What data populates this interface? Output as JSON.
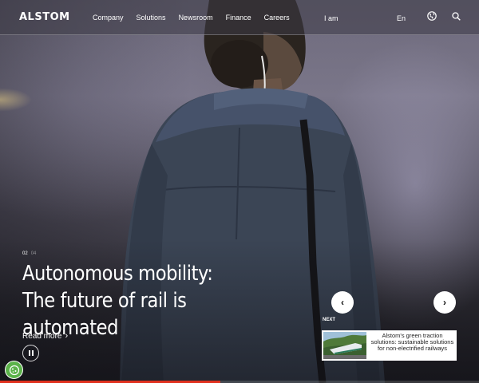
{
  "header": {
    "logo": "ALSTOM",
    "nav": [
      "Company",
      "Solutions",
      "Newsroom",
      "Finance",
      "Careers"
    ],
    "iam": "I am",
    "language": "En",
    "icons": {
      "globe": "globe-icon",
      "search": "search-icon"
    }
  },
  "slide": {
    "current": "02",
    "total": "04",
    "title": "Autonomous mobility: The future of rail is automated",
    "read_more": "Read more",
    "progress": 0.46
  },
  "next": {
    "label": "NEXT",
    "card_text": "Alstom's green traction solutions: sustainable solutions for non-electrified railways"
  },
  "colors": {
    "accent": "#e0301e",
    "cookie": "#5bb24a"
  }
}
